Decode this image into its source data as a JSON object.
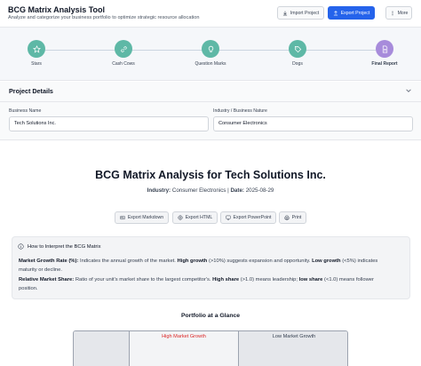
{
  "header": {
    "title": "BCG Matrix Analysis Tool",
    "subtitle": "Analyze and categorize your business portfolio to optimize strategic resource allocation",
    "import_label": "Import Project",
    "export_label": "Export Project",
    "more_label": "More"
  },
  "steps": [
    {
      "label": "Stars",
      "icon": "star-icon",
      "color": "#5eb8a6"
    },
    {
      "label": "Cash Cows",
      "icon": "link-icon",
      "color": "#5eb8a6"
    },
    {
      "label": "Question Marks",
      "icon": "lightbulb-icon",
      "color": "#5eb8a6"
    },
    {
      "label": "Dogs",
      "icon": "tag-icon",
      "color": "#5eb8a6"
    },
    {
      "label": "Final Report",
      "icon": "document-icon",
      "color": "#a78bdb"
    }
  ],
  "project": {
    "section_title": "Project Details",
    "business_name_label": "Business Name",
    "business_name_value": "Tech Solutions Inc.",
    "industry_label": "Industry / Business Nature",
    "industry_value": "Consumer Electronics"
  },
  "report": {
    "title": "BCG Matrix Analysis for Tech Solutions Inc.",
    "industry_key": "Industry:",
    "industry_value": "Consumer Electronics",
    "date_key": "Date:",
    "date_value": "2025-08-29",
    "separator": "|",
    "exports": [
      "Export Markdown",
      "Export HTML",
      "Export PowerPoint",
      "Print"
    ]
  },
  "info": {
    "heading": "How to Interpret the BCG Matrix",
    "growth_key": "Market Growth Rate (%):",
    "growth_text_1": "Indicates the annual growth of the market.",
    "high_growth": "High growth",
    "growth_text_2": "(>10%) suggests expansion and opportunity.",
    "low_growth": "Low growth",
    "growth_text_3": "(<5%) indicates maturity or decline.",
    "share_key": "Relative Market Share:",
    "share_text_1": "Ratio of your unit's market share to the largest competitor's.",
    "high_share": "High share",
    "share_text_2": "(>1.0) means leadership;",
    "low_share": "low share",
    "share_text_3": "(<1.0) means follower position."
  },
  "portfolio": {
    "title": "Portfolio at a Glance",
    "high_growth_header": "High Market Growth",
    "low_growth_header": "Low Market Growth",
    "high_color": "#dc2626",
    "low_color": "#374151"
  },
  "colors": {
    "primary": "#2563eb",
    "step_complete": "#5eb8a6",
    "step_final": "#a78bdb"
  }
}
